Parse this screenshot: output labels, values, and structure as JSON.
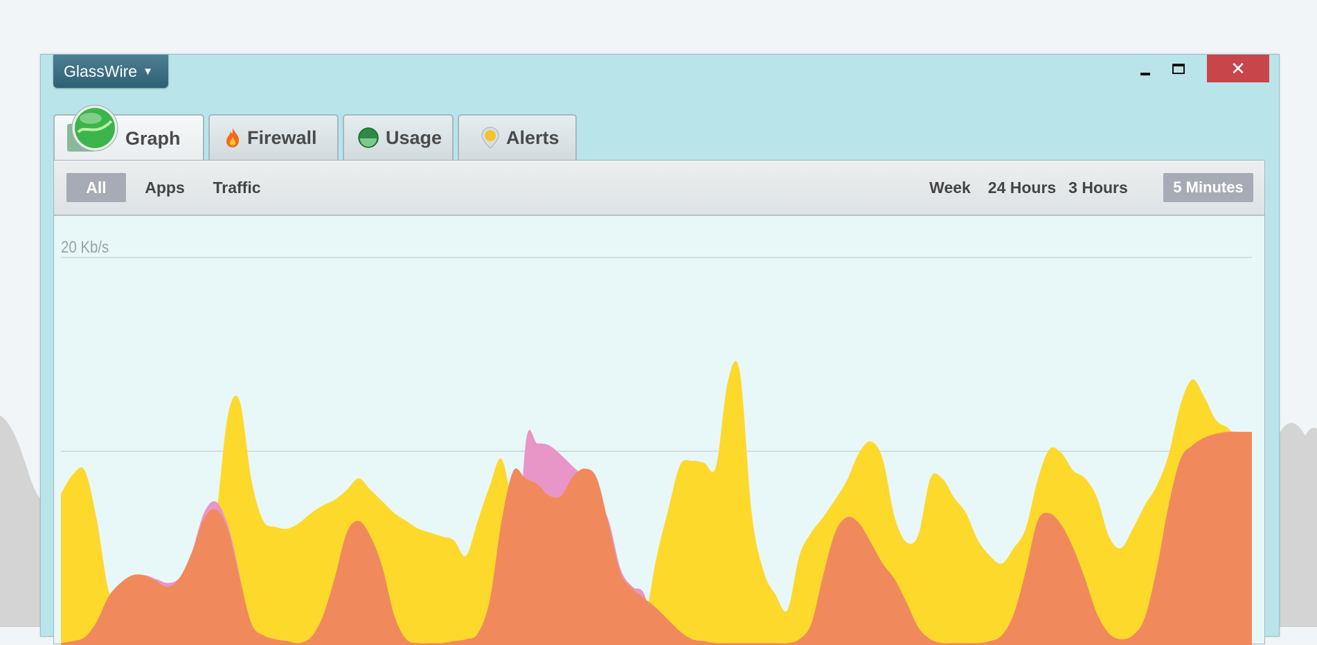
{
  "app": {
    "menu_label": "GlassWire",
    "caret_icon": "caret-down-icon",
    "close_glyph": "✕"
  },
  "tabs": [
    {
      "label": "Graph",
      "icon": "graph-logo-icon",
      "active": true
    },
    {
      "label": "Firewall",
      "icon": "flame-icon",
      "active": false
    },
    {
      "label": "Usage",
      "icon": "usage-gauge-icon",
      "active": false
    },
    {
      "label": "Alerts",
      "icon": "alert-pin-icon",
      "active": false
    }
  ],
  "filters": [
    {
      "label": "All",
      "selected": true
    },
    {
      "label": "Apps",
      "selected": false
    },
    {
      "label": "Traffic",
      "selected": false
    }
  ],
  "ranges": [
    {
      "label": "Week",
      "selected": false
    },
    {
      "label": "24 Hours",
      "selected": false
    },
    {
      "label": "3 Hours",
      "selected": false
    },
    {
      "label": "5 Minutes",
      "selected": true
    }
  ],
  "colors": {
    "incoming": "#fdd92c",
    "outgoing": "#f08a5c",
    "pink": "#e895c7",
    "accent_close": "#c8454a"
  },
  "chart_data": {
    "type": "area",
    "ylabel": "20 Kb/s",
    "ylim": [
      0,
      20
    ],
    "x": [
      0,
      1,
      2,
      3,
      4,
      5,
      6,
      7,
      8,
      9,
      10,
      11,
      12,
      13,
      14,
      15,
      16,
      17,
      18,
      19,
      20,
      21,
      22,
      23,
      24,
      25,
      26,
      27,
      28,
      29,
      30,
      31,
      32,
      33,
      34,
      35,
      36,
      37,
      38,
      39,
      40,
      41,
      42,
      43,
      44,
      45,
      46,
      47,
      48,
      49,
      50,
      51,
      52,
      53,
      54,
      55,
      56,
      57,
      58,
      59,
      60,
      61,
      62,
      63,
      64,
      65,
      66,
      67,
      68,
      69,
      70,
      71,
      72,
      73,
      74,
      75,
      76,
      77,
      78,
      79,
      80,
      81,
      82,
      83,
      84,
      85,
      86,
      87,
      88,
      89,
      90,
      91,
      92,
      93,
      94,
      95,
      96,
      97,
      98,
      99,
      100
    ],
    "series": [
      {
        "values": [
          7.8,
          8.8,
          9.0,
          6.5,
          2.8,
          1.8,
          0.6,
          1.2,
          2.2,
          2.8,
          3.0,
          3.4,
          3.8,
          6.5,
          11.8,
          12.6,
          8.5,
          6.4,
          6.1,
          6.0,
          6.3,
          6.8,
          7.2,
          7.5,
          8.0,
          8.6,
          8.0,
          7.4,
          6.8,
          6.4,
          6.0,
          5.8,
          5.6,
          5.4,
          4.6,
          6.4,
          8.2,
          9.6,
          6.8,
          3.2,
          2.5,
          2.2,
          1.9,
          1.5,
          1.3,
          1.2,
          1.1,
          1.0,
          1.2,
          1.3,
          4.5,
          7.0,
          9.3,
          9.5,
          9.4,
          9.2,
          13.6,
          14.1,
          6.8,
          3.8,
          2.6,
          1.8,
          4.6,
          5.8,
          6.6,
          7.5,
          8.5,
          9.9,
          10.5,
          9.6,
          6.6,
          5.3,
          5.7,
          8.6,
          8.6,
          7.6,
          6.8,
          5.4,
          4.6,
          4.2,
          5.0,
          6.0,
          8.5,
          10.1,
          9.9,
          9.0,
          8.6,
          7.6,
          5.6,
          5.0,
          6.0,
          7.2,
          8.2,
          9.8,
          12.4,
          13.7,
          12.8,
          11.6,
          11.2,
          10.5,
          10.8
        ]
      },
      {
        "values": [
          0.1,
          0.2,
          0.4,
          1.2,
          2.5,
          3.2,
          3.6,
          3.6,
          3.3,
          3.0,
          3.5,
          4.8,
          6.5,
          7.0,
          6.0,
          3.5,
          1.1,
          0.5,
          0.3,
          0.2,
          0.1,
          0.4,
          1.5,
          3.5,
          5.8,
          6.4,
          5.6,
          4.0,
          1.5,
          0.3,
          0.1,
          0.1,
          0.1,
          0.2,
          0.3,
          0.6,
          2.3,
          6.4,
          9.0,
          8.6,
          8.3,
          7.7,
          7.7,
          8.7,
          9.1,
          8.6,
          6.2,
          3.7,
          2.9,
          2.4,
          1.9,
          1.3,
          0.7,
          0.3,
          0.2,
          0.1,
          0.1,
          0.1,
          0.1,
          0.1,
          0.1,
          0.1,
          0.3,
          1.1,
          3.6,
          5.8,
          6.6,
          6.3,
          5.3,
          4.2,
          3.4,
          2.2,
          0.9,
          0.3,
          0.1,
          0.1,
          0.1,
          0.1,
          0.2,
          0.5,
          1.6,
          3.8,
          6.4,
          6.8,
          6.2,
          5.0,
          3.4,
          1.6,
          0.6,
          0.3,
          0.5,
          1.4,
          3.9,
          7.2,
          9.6,
          10.3,
          10.7,
          10.9,
          11.0,
          11.0,
          11.0
        ]
      },
      {
        "values": [
          0,
          0,
          0,
          0,
          0,
          2.6,
          3.4,
          3.6,
          3.4,
          3.2,
          3.5,
          4.8,
          6.8,
          7.4,
          6.2,
          3.6,
          0,
          0,
          0,
          0,
          0,
          0,
          0,
          0,
          0,
          0,
          0,
          0,
          0,
          0,
          0,
          0,
          0,
          0,
          0,
          0,
          0,
          0,
          0,
          10.3,
          10.4,
          10.3,
          9.8,
          9.2,
          8.6,
          7.7,
          6.4,
          3.9,
          3.0,
          2.6,
          0,
          0,
          0,
          0,
          0,
          0,
          0,
          0,
          0,
          0,
          0,
          0,
          0,
          0,
          0,
          0,
          0,
          0,
          0,
          0,
          0,
          0,
          0,
          0,
          0,
          0,
          0,
          0,
          0,
          0,
          0,
          0,
          0,
          0,
          0,
          0,
          0,
          0,
          0,
          0,
          0,
          0,
          0,
          0,
          0,
          0,
          0,
          0,
          0,
          0,
          0
        ]
      }
    ]
  }
}
